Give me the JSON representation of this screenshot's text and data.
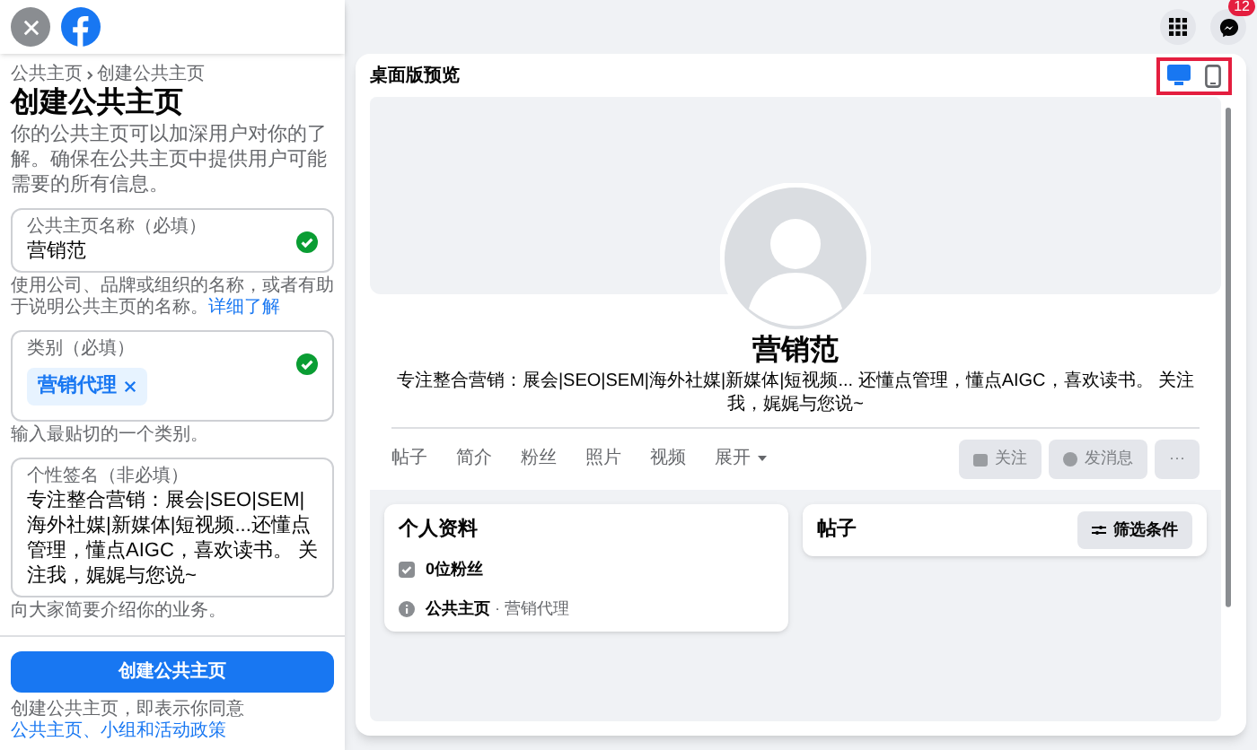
{
  "sidebar": {
    "breadcrumb": [
      {
        "label": "公共主页"
      },
      {
        "label": "创建公共主页"
      }
    ],
    "title": "创建公共主页",
    "description": "你的公共主页可以加深用户对你的了解。确保在公共主页中提供用户可能需要的所有信息。",
    "fields": [
      {
        "kind": "text",
        "label": "公共主页名称（必填）",
        "value": "营销范",
        "valid": true,
        "help": "使用公司、品牌或组织的名称，或者有助于说明公共主页的名称。",
        "help_link": "详细了解"
      },
      {
        "kind": "tags",
        "label": "类别（必填）",
        "tags": [
          "营销代理"
        ],
        "valid": true,
        "help": "输入最贴切的一个类别。"
      },
      {
        "kind": "textarea",
        "label": "个性签名（非必填）",
        "value": "专注整合营销：展会|SEO|SEM|海外社媒|新媒体|短视频...还懂点管理，懂点AIGC，喜欢读书。 关注我，娓娓与您说~",
        "help": "向大家简要介绍你的业务。"
      }
    ],
    "submit": "创建公共主页",
    "terms": "创建公共主页，即表示你同意",
    "terms_link": "公共主页、小组和活动政策"
  },
  "topbar": {
    "badge": "12"
  },
  "preview": {
    "title": "桌面版预览",
    "views": [
      {
        "kind": "desktop",
        "selected": true
      },
      {
        "kind": "mobile",
        "selected": false
      }
    ],
    "page_name": "营销范",
    "bio": "专注整合营销：展会|SEO|SEM|海外社媒|新媒体|短视频... 还懂点管理，懂点AIGC，喜欢读书。 关注我，娓娓与您说~",
    "tabs": [
      "帖子",
      "简介",
      "粉丝",
      "照片",
      "视频"
    ],
    "more_tab": "展开",
    "actions": [
      {
        "kind": "follow",
        "label": "关注",
        "disabled": true
      },
      {
        "kind": "message",
        "label": "发消息",
        "disabled": true
      },
      {
        "kind": "more",
        "label": "···",
        "disabled": true
      }
    ],
    "profile": {
      "title": "个人资料",
      "followers": "0位粉丝",
      "type_label": "公共主页",
      "separator": "·",
      "type_value": "营销代理"
    },
    "posts": {
      "title": "帖子",
      "filter": "筛选条件"
    }
  }
}
